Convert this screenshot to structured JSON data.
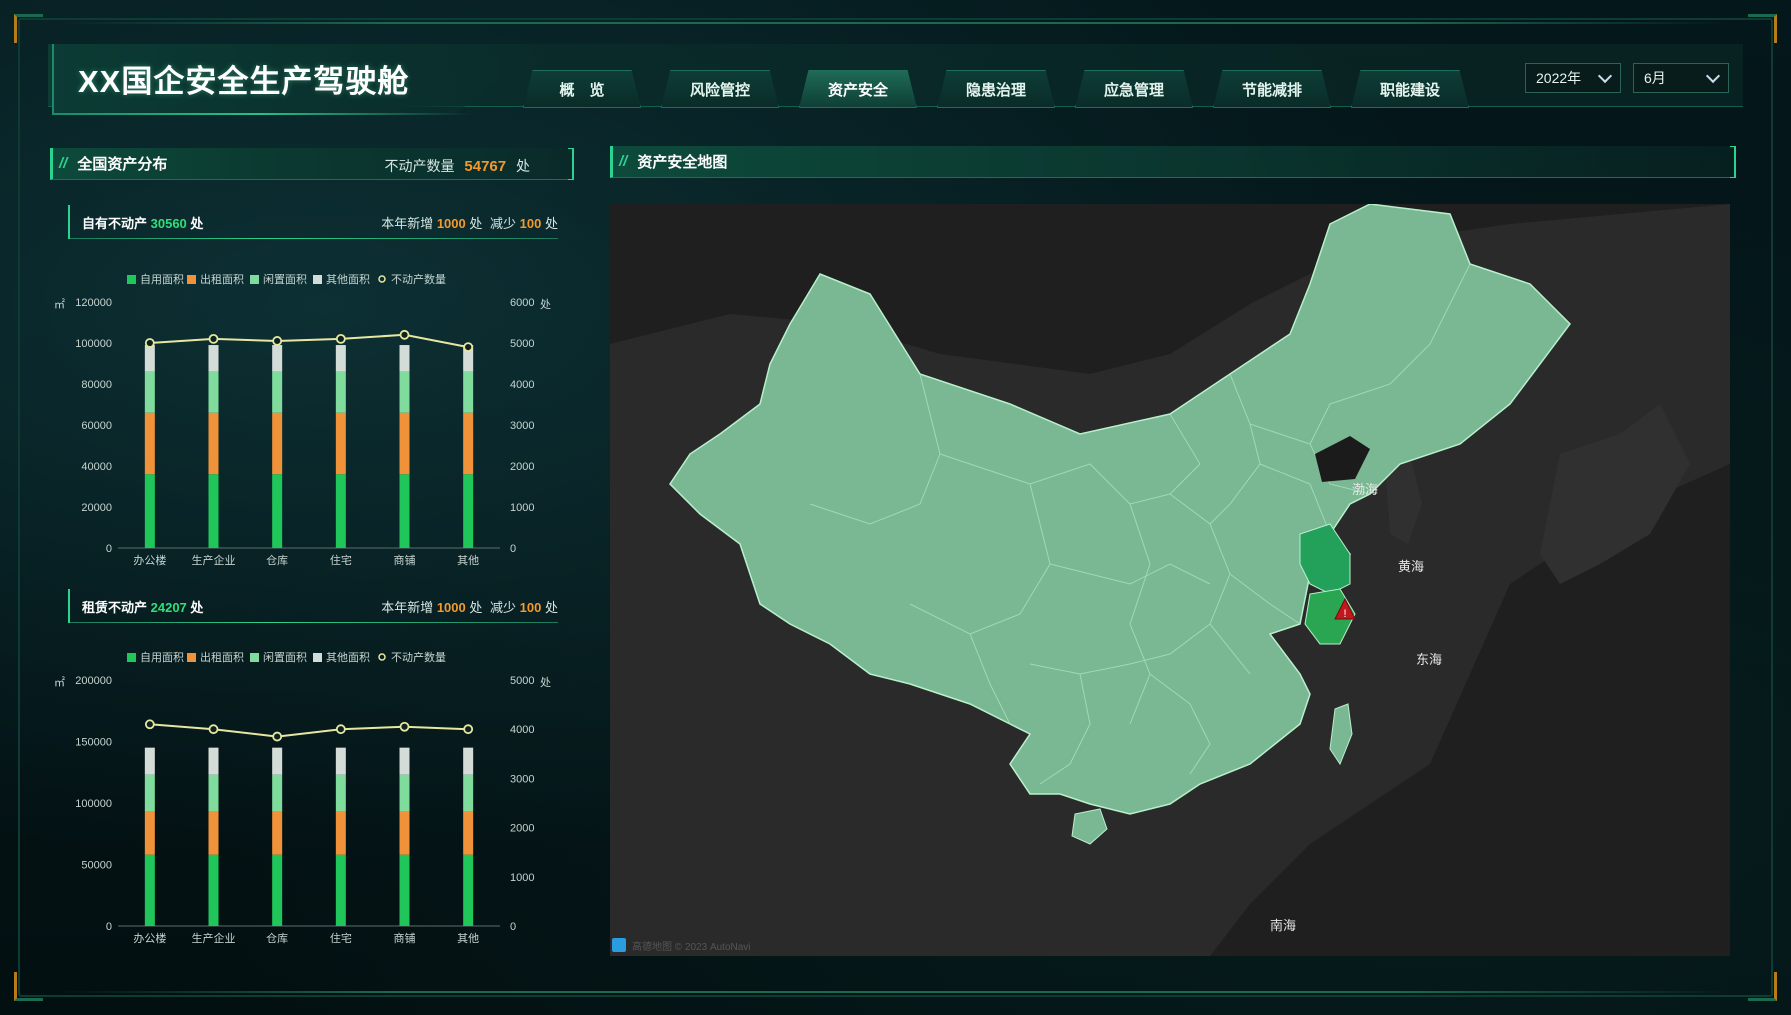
{
  "header": {
    "title": "XX国企安全生产驾驶舱",
    "tabs": [
      {
        "label": "概　览"
      },
      {
        "label": "风险管控"
      },
      {
        "label": "资产安全"
      },
      {
        "label": "隐患治理"
      },
      {
        "label": "应急管理"
      },
      {
        "label": "节能减排"
      },
      {
        "label": "职能建设"
      }
    ],
    "active_tab": "资产安全",
    "year_select": "2022年",
    "month_select": "6月"
  },
  "left_panel": {
    "title": "全国资产分布",
    "total_label": "不动产数量",
    "total_value": "54767",
    "total_unit": "处"
  },
  "owned": {
    "label": "自有不动产",
    "count": "30560",
    "unit": "处",
    "new_label": "本年新增",
    "new_value": "1000",
    "new_unit": "处",
    "reduce_label": "减少",
    "reduce_value": "100",
    "reduce_unit": "处"
  },
  "rented": {
    "label": "租赁不动产",
    "count": "24207",
    "unit": "处",
    "new_label": "本年新增",
    "new_value": "1000",
    "new_unit": "处",
    "reduce_label": "减少",
    "reduce_value": "100",
    "reduce_unit": "处"
  },
  "legend": [
    "自用面积",
    "出租面积",
    "闲置面积",
    "其他面积",
    "不动产数量"
  ],
  "colors": {
    "self_use": "#21c65a",
    "rent_out": "#f0923a",
    "idle": "#7fdc9c",
    "other": "#d4dcd8",
    "count_line": "#e8e6a0",
    "accent": "#2ad38f"
  },
  "chart_data": [
    {
      "type": "bar",
      "stacked": true,
      "categories": [
        "办公楼",
        "生产企业",
        "仓库",
        "住宅",
        "商铺",
        "其他"
      ],
      "y_left_unit": "㎡",
      "y_right_unit": "处",
      "ylim": [
        0,
        120000
      ],
      "y2lim": [
        0,
        6000
      ],
      "y_ticks": [
        "0",
        "20000",
        "40000",
        "60000",
        "80000",
        "100000",
        "120000"
      ],
      "y2_ticks": [
        "0",
        "1000",
        "2000",
        "3000",
        "4000",
        "5000",
        "6000"
      ],
      "series": [
        {
          "name": "自用面积",
          "values": [
            36000,
            36000,
            36000,
            36000,
            36000,
            36000
          ]
        },
        {
          "name": "出租面积",
          "values": [
            30000,
            30000,
            30000,
            30000,
            30000,
            30000
          ]
        },
        {
          "name": "闲置面积",
          "values": [
            20000,
            20000,
            20000,
            20000,
            20000,
            20000
          ]
        },
        {
          "name": "其他面积",
          "values": [
            13000,
            13000,
            13000,
            13000,
            13000,
            13000
          ]
        },
        {
          "name": "不动产数量",
          "axis": "right",
          "kind": "line",
          "values": [
            5000,
            5100,
            5050,
            5100,
            5200,
            4900
          ]
        }
      ],
      "legend_placement": "top"
    },
    {
      "type": "bar",
      "stacked": true,
      "categories": [
        "办公楼",
        "生产企业",
        "仓库",
        "住宅",
        "商铺",
        "其他"
      ],
      "y_left_unit": "㎡",
      "y_right_unit": "处",
      "ylim": [
        0,
        200000
      ],
      "y2lim": [
        0,
        5000
      ],
      "y_ticks": [
        "0",
        "50000",
        "100000",
        "150000",
        "200000"
      ],
      "y2_ticks": [
        "0",
        "1000",
        "2000",
        "3000",
        "4000",
        "5000"
      ],
      "series": [
        {
          "name": "自用面积",
          "values": [
            58000,
            58000,
            58000,
            58000,
            58000,
            58000
          ]
        },
        {
          "name": "出租面积",
          "values": [
            35000,
            35000,
            35000,
            35000,
            35000,
            35000
          ]
        },
        {
          "name": "闲置面积",
          "values": [
            30000,
            30000,
            30000,
            30000,
            30000,
            30000
          ]
        },
        {
          "name": "其他面积",
          "values": [
            22000,
            22000,
            22000,
            22000,
            22000,
            22000
          ]
        },
        {
          "name": "不动产数量",
          "axis": "right",
          "kind": "line",
          "values": [
            4100,
            4000,
            3850,
            4000,
            4050,
            4000
          ]
        }
      ],
      "legend_placement": "top"
    }
  ],
  "map_panel": {
    "title": "资产安全地图",
    "labels": {
      "bohai": "渤海",
      "yellow_sea": "黄海",
      "east_sea": "东海",
      "south_sea": "南海"
    },
    "attribution": "高德地图 © 2023 AutoNavi",
    "warning_marker": "!"
  }
}
